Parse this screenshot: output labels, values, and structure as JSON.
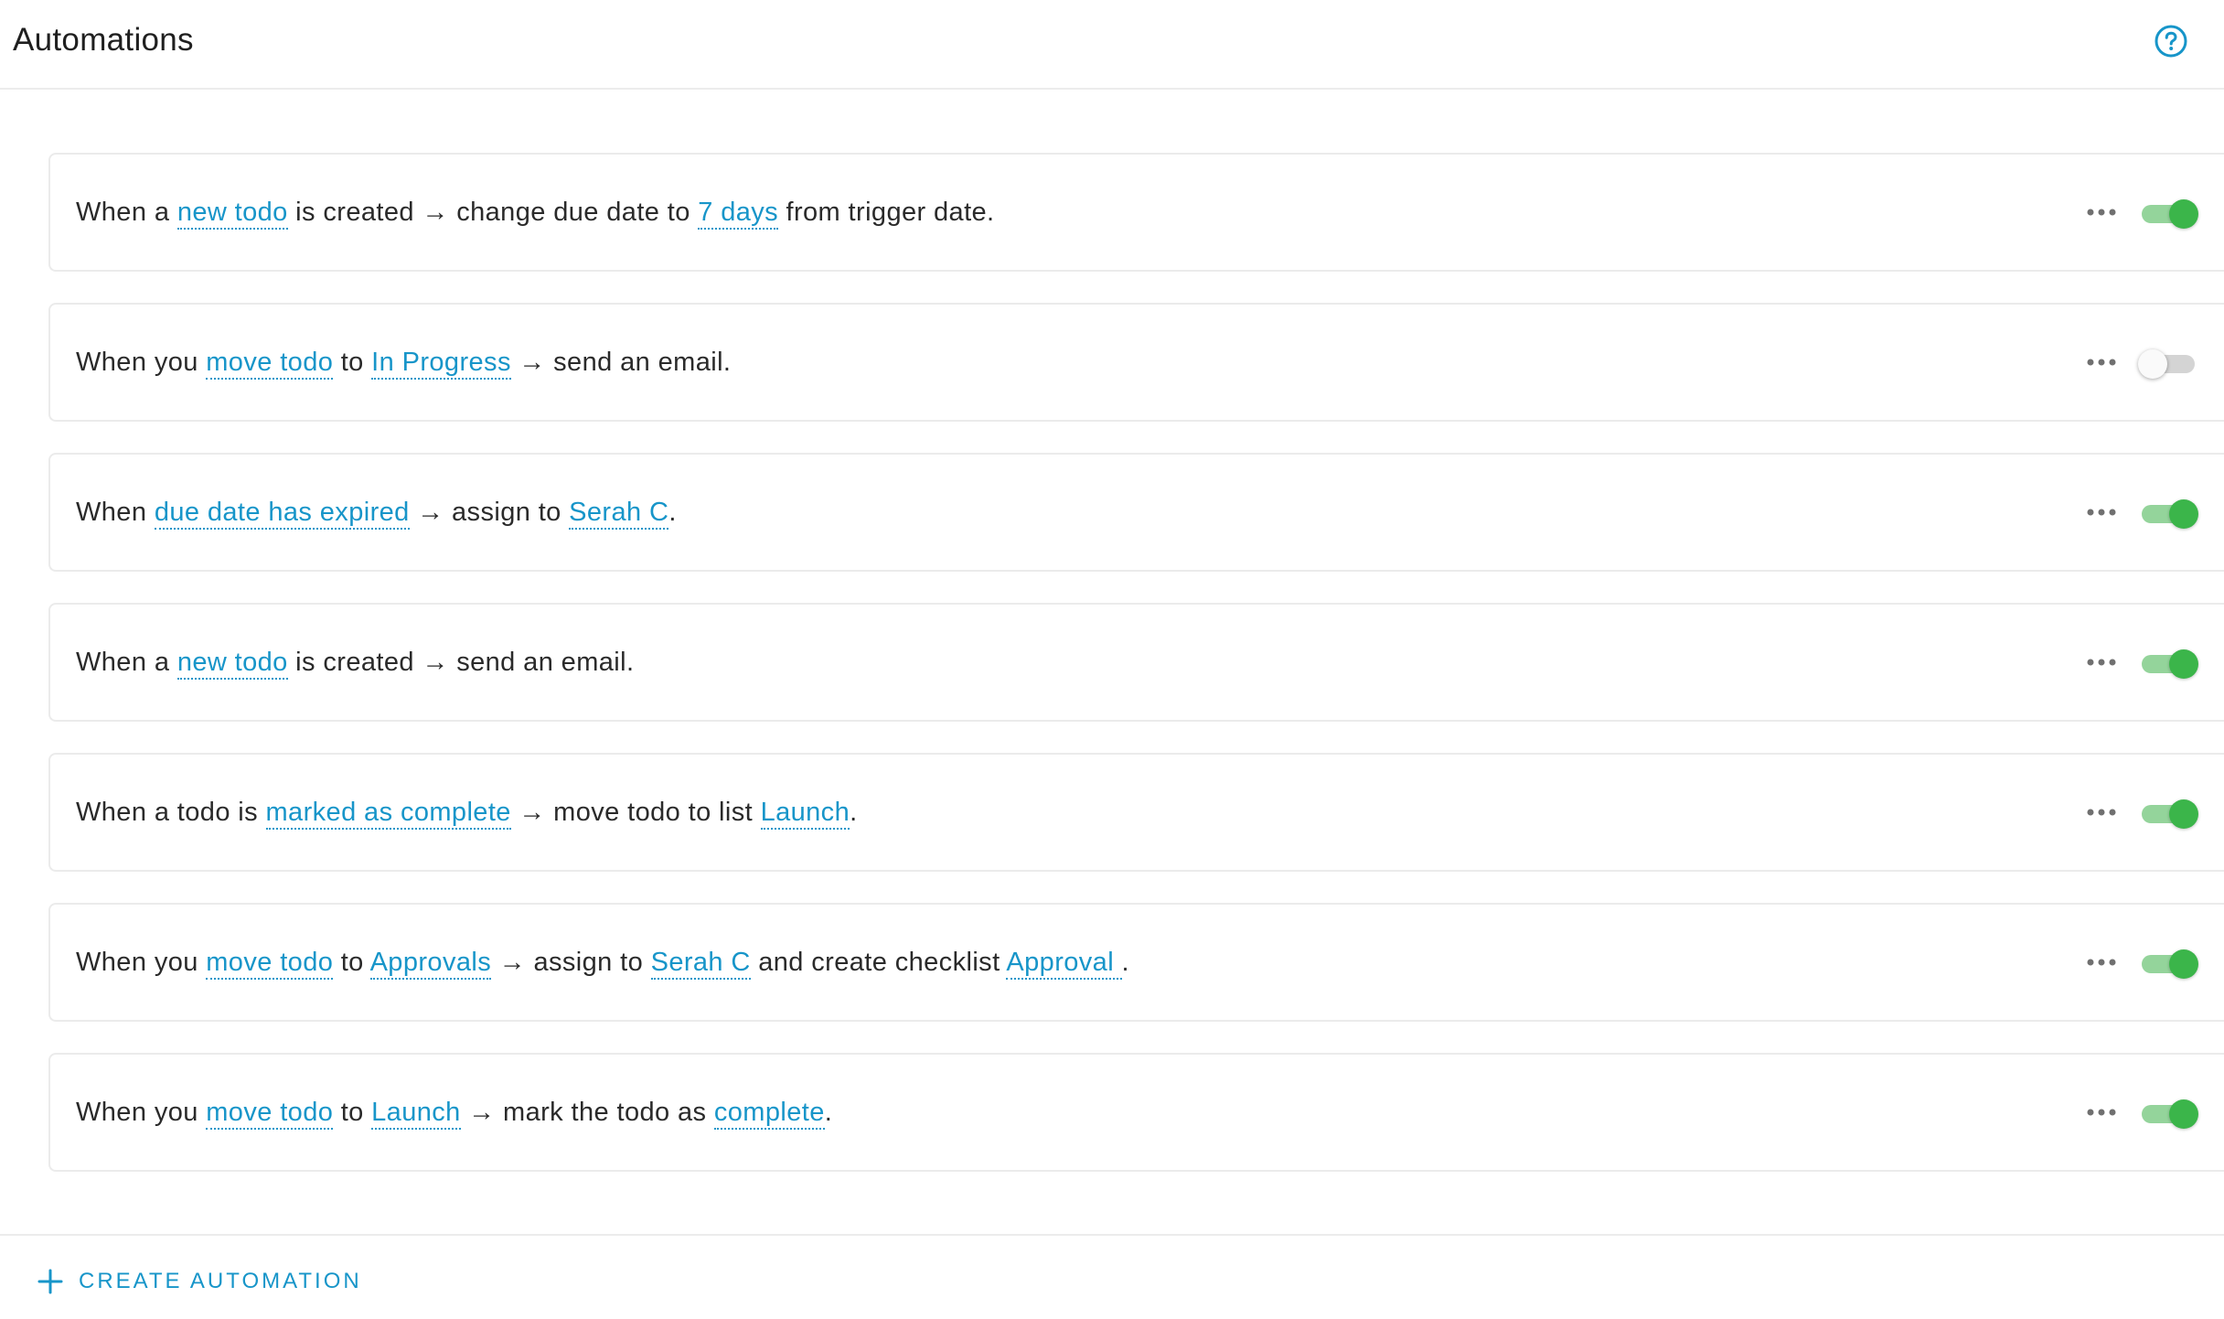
{
  "header": {
    "title": "Automations",
    "help_icon": "help-circle-icon"
  },
  "colors": {
    "accent": "#1795c9",
    "toggle_on": "#3bb54a",
    "toggle_on_track": "#94d49b",
    "toggle_off_track": "#d4d4d4",
    "border": "#ebebeb"
  },
  "automations": [
    {
      "enabled": true,
      "parts": [
        {
          "text": "When a "
        },
        {
          "text": "new todo",
          "token": true
        },
        {
          "text": " is created → change due date to "
        },
        {
          "text": "7 days",
          "token": true
        },
        {
          "text": " from trigger date."
        }
      ]
    },
    {
      "enabled": false,
      "parts": [
        {
          "text": "When you "
        },
        {
          "text": "move todo",
          "token": true
        },
        {
          "text": " to "
        },
        {
          "text": "In Progress",
          "token": true
        },
        {
          "text": " → send an email."
        }
      ]
    },
    {
      "enabled": true,
      "parts": [
        {
          "text": "When "
        },
        {
          "text": "due date has expired",
          "token": true
        },
        {
          "text": " → assign to "
        },
        {
          "text": "Serah C",
          "token": true
        },
        {
          "text": "."
        }
      ]
    },
    {
      "enabled": true,
      "parts": [
        {
          "text": "When a "
        },
        {
          "text": "new todo",
          "token": true
        },
        {
          "text": " is created → send an email."
        }
      ]
    },
    {
      "enabled": true,
      "parts": [
        {
          "text": "When a todo is "
        },
        {
          "text": "marked as complete",
          "token": true
        },
        {
          "text": " → move todo to list "
        },
        {
          "text": "Launch",
          "token": true
        },
        {
          "text": "."
        }
      ]
    },
    {
      "enabled": true,
      "parts": [
        {
          "text": "When you "
        },
        {
          "text": "move todo",
          "token": true
        },
        {
          "text": " to "
        },
        {
          "text": "Approvals",
          "token": true
        },
        {
          "text": " → assign to "
        },
        {
          "text": "Serah C",
          "token": true
        },
        {
          "text": " and create checklist "
        },
        {
          "text": "Approval ",
          "token": true
        },
        {
          "text": "."
        }
      ]
    },
    {
      "enabled": true,
      "parts": [
        {
          "text": "When you "
        },
        {
          "text": "move todo",
          "token": true
        },
        {
          "text": " to "
        },
        {
          "text": "Launch",
          "token": true
        },
        {
          "text": " → mark the todo as "
        },
        {
          "text": "complete",
          "token": true
        },
        {
          "text": "."
        }
      ]
    }
  ],
  "footer": {
    "create_label": "CREATE AUTOMATION",
    "create_icon": "plus-icon"
  }
}
